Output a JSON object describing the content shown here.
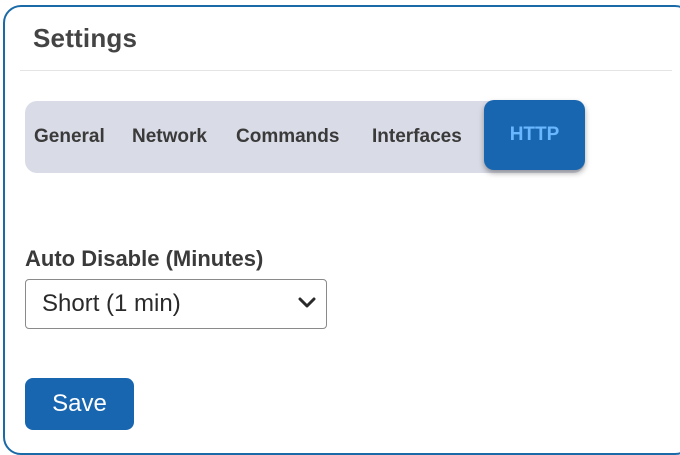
{
  "header": {
    "title": "Settings"
  },
  "tabs": [
    {
      "label": "General",
      "active": false
    },
    {
      "label": "Network",
      "active": false
    },
    {
      "label": "Commands",
      "active": false
    },
    {
      "label": "Interfaces",
      "active": false
    },
    {
      "label": "HTTP",
      "active": true
    }
  ],
  "form": {
    "auto_disable_label": "Auto Disable (Minutes)",
    "auto_disable_value": "Short (1 min)"
  },
  "actions": {
    "save_label": "Save"
  },
  "icons": {
    "select_arrow": "chevron-down-icon"
  },
  "colors": {
    "accent": "#1866b0",
    "active_tab_text": "#6ab7ff",
    "tabbar_bg": "#d9dbe6",
    "panel_border": "#1b6aa8"
  }
}
